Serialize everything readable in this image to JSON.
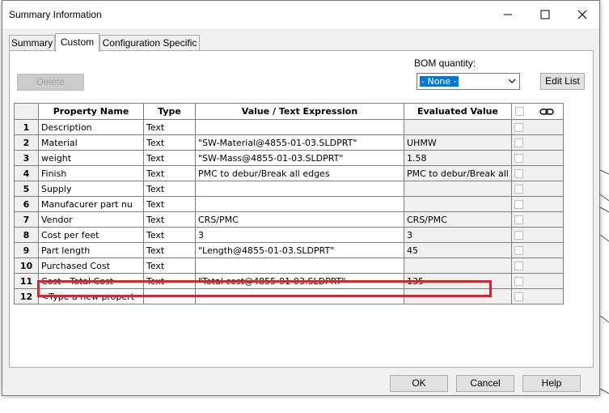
{
  "window": {
    "title": "Summary Information"
  },
  "tabs": [
    {
      "label": "Summary"
    },
    {
      "label": "Custom"
    },
    {
      "label": "Configuration Specific"
    }
  ],
  "toolbar": {
    "delete_label": "Delete",
    "bom_label": "BOM quantity:",
    "bom_value": "- None -",
    "edit_list_label": "Edit List"
  },
  "table": {
    "headers": {
      "property": "Property Name",
      "type": "Type",
      "value": "Value / Text Expression",
      "evaluated": "Evaluated Value"
    },
    "rows": [
      {
        "num": "1",
        "name": "Description",
        "type": "Text",
        "value": "",
        "evaluated": ""
      },
      {
        "num": "2",
        "name": "Material",
        "type": "Text",
        "value": "\"SW-Material@4855-01-03.SLDPRT\"",
        "evaluated": "UHMW"
      },
      {
        "num": "3",
        "name": "weight",
        "type": "Text",
        "value": "\"SW-Mass@4855-01-03.SLDPRT\"",
        "evaluated": "1.58"
      },
      {
        "num": "4",
        "name": "Finish",
        "type": "Text",
        "value": "PMC to debur/Break all edges",
        "evaluated": "PMC to debur/Break all"
      },
      {
        "num": "5",
        "name": "Supply",
        "type": "Text",
        "value": "",
        "evaluated": ""
      },
      {
        "num": "6",
        "name": "Manufacurer part nu",
        "type": "Text",
        "value": "",
        "evaluated": ""
      },
      {
        "num": "7",
        "name": "Vendor",
        "type": "Text",
        "value": "CRS/PMC",
        "evaluated": "CRS/PMC"
      },
      {
        "num": "8",
        "name": "Cost per feet",
        "type": "Text",
        "value": "3",
        "evaluated": "3"
      },
      {
        "num": "9",
        "name": "Part length",
        "type": "Text",
        "value": "\"Length@4855-01-03.SLDPRT\"",
        "evaluated": "45"
      },
      {
        "num": "10",
        "name": "Purchased Cost",
        "type": "Text",
        "value": "",
        "evaluated": ""
      },
      {
        "num": "11",
        "name": "Cost - Total Cost",
        "type": "Text",
        "value": "\"Total cost@4855-01-03.SLDPRT\"",
        "evaluated": "135"
      },
      {
        "num": "12",
        "name": "<Type a new propert",
        "type": "",
        "value": "",
        "evaluated": ""
      }
    ]
  },
  "footer": {
    "ok_label": "OK",
    "cancel_label": "Cancel",
    "help_label": "Help"
  },
  "colors": {
    "highlight": "#e0202a",
    "selection": "#0078d7"
  },
  "icons": {
    "link_column": "link-icon",
    "close": "close-icon",
    "maximize": "maximize-icon",
    "minimize": "minimize-icon"
  }
}
